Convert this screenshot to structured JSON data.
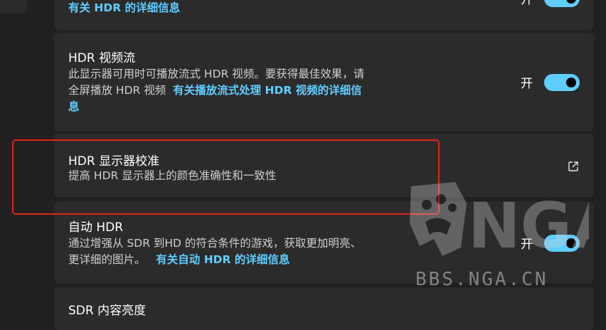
{
  "cards": {
    "top": {
      "link": "有关 HDR 的详细信息",
      "toggle": "开"
    },
    "video": {
      "title": "HDR 视频流",
      "desc1": "此显示器可用时可播放流式 HDR 视频。要获得最佳效果，请",
      "desc2": "全屏播放 HDR 视频",
      "link1": "有关播放流式处理 HDR 视频的详细信",
      "link2": "息",
      "toggle": "开"
    },
    "calib": {
      "title": "HDR 显示器校准",
      "desc": "提高 HDR 显示器上的颜色准确性和一致性"
    },
    "auto": {
      "title": "自动 HDR",
      "desc1": "通过增强从 SDR 到HD 的符合条件的游戏，获取更加明亮、",
      "desc2": "更详细的图片。",
      "link": "有关自动 HDR 的详细信息",
      "toggle": "开"
    },
    "bottom": {
      "title": "SDR 内容亮度"
    }
  },
  "watermark": {
    "logo": "NGA",
    "site": "BBS.NGA.CN"
  },
  "colors": {
    "accent": "#60cdff",
    "card": "#2b2b2b",
    "background": "#202020",
    "highlight": "#e0221b"
  }
}
